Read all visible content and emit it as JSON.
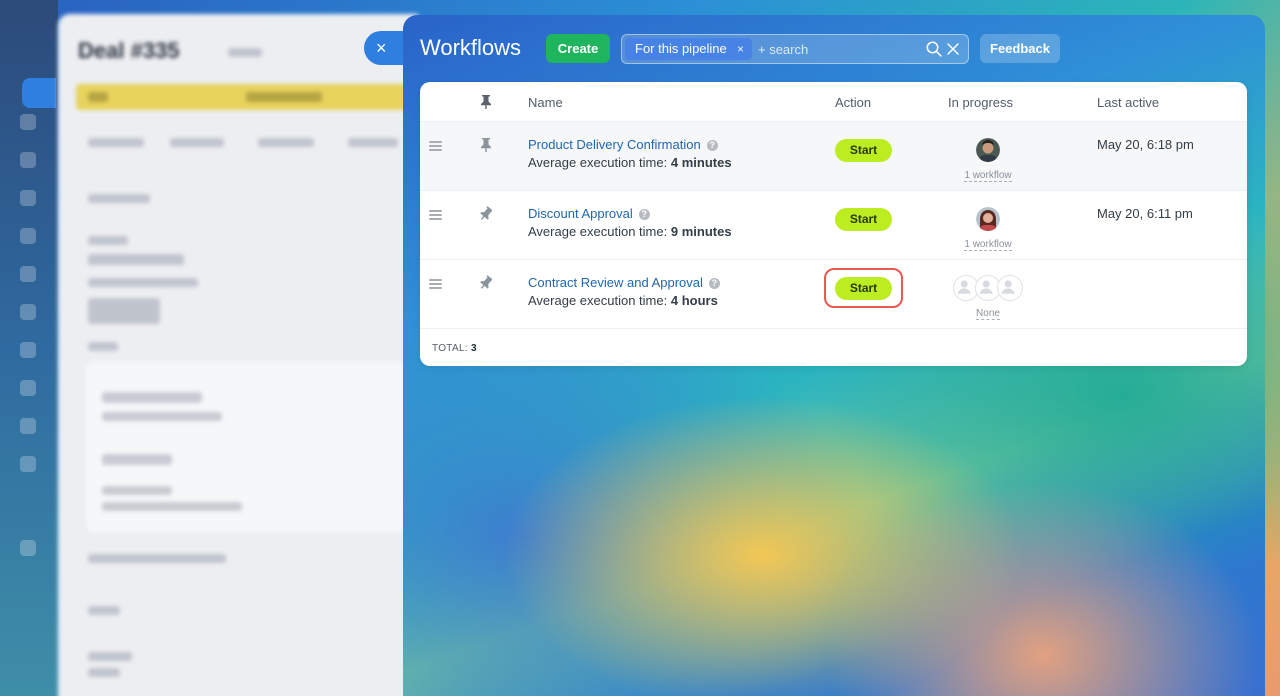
{
  "background": {
    "deal_title": "Deal #335"
  },
  "close_tab": {
    "icon": "close-icon",
    "glyph": "×"
  },
  "panel": {
    "title": "Workflows",
    "create_label": "Create",
    "filter_chip": "For this pipeline",
    "filter_chip_remove": "×",
    "search_placeholder": "+ search",
    "feedback_label": "Feedback"
  },
  "table": {
    "columns": {
      "name": "Name",
      "action": "Action",
      "in_progress": "In progress",
      "last_active": "Last active"
    },
    "rows": [
      {
        "name": "Product Delivery Confirmation",
        "sub_label": "Average execution time:",
        "duration": "4 minutes",
        "action": "Start",
        "progress": "1 workflow",
        "last_active": "May 20, 6:18 pm",
        "pinned": true
      },
      {
        "name": "Discount Approval",
        "sub_label": "Average execution time:",
        "duration": "9 minutes",
        "action": "Start",
        "progress": "1 workflow",
        "last_active": "May 20, 6:11 pm",
        "pinned": false
      },
      {
        "name": "Contract Review and Approval",
        "sub_label": "Average execution time:",
        "duration": "4 hours",
        "action": "Start",
        "progress": "None",
        "last_active": "",
        "pinned": false
      }
    ],
    "total_label": "TOTAL:",
    "total_value": "3"
  },
  "colors": {
    "start_button": "#bbed21",
    "create_button": "#1fb55f",
    "link": "#2067b0",
    "highlight": "#ea5a4f"
  }
}
